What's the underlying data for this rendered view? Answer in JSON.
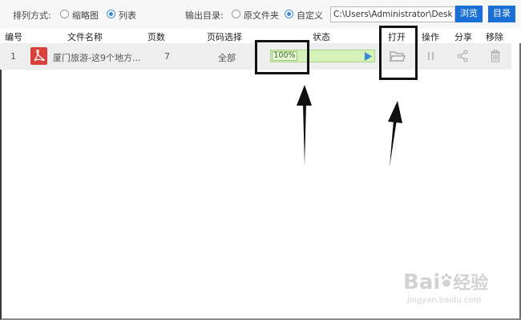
{
  "toolbar": {
    "sort_label": "排列方式:",
    "sort_options": [
      {
        "label": "缩略图",
        "selected": false
      },
      {
        "label": "列表",
        "selected": true
      }
    ],
    "output_label": "输出目录:",
    "output_options": [
      {
        "label": "原文件夹",
        "selected": false
      },
      {
        "label": "自定义",
        "selected": true
      }
    ],
    "output_path": "C:\\Users\\Administrator\\Desktop",
    "browse_label": "浏览",
    "dir_label": "目录"
  },
  "table": {
    "headers": {
      "index": "编号",
      "filename": "文件名称",
      "pages": "页数",
      "page_select": "页码选择",
      "status": "状态",
      "open": "打开",
      "action": "操作",
      "share": "分享",
      "remove": "移除"
    },
    "rows": [
      {
        "index": "1",
        "filename": "厦门旅游-这9个地方...",
        "pages": "7",
        "page_select": "全部",
        "progress_text": "100%",
        "progress": 1.0
      }
    ]
  },
  "watermark": {
    "brand_a": "Bai",
    "brand_b": "经验",
    "url": "jingyan.baidu.com"
  },
  "colors": {
    "accent_blue": "#1a6fd6",
    "progress_green": "#d6f2b8",
    "pdf_red": "#d9413a",
    "row_bg": "#eeeeee"
  }
}
